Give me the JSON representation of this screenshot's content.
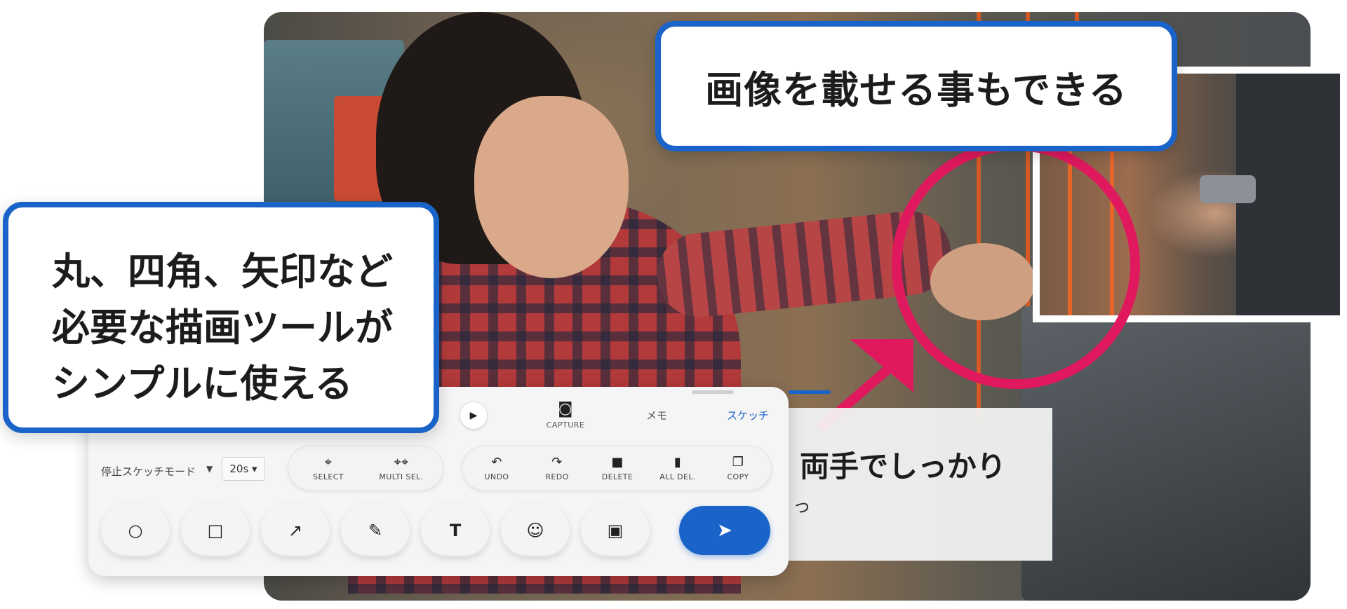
{
  "callouts": {
    "top": "画像を載せる事もできる",
    "left_lines": [
      "丸、四角、矢印など",
      "必要な描画ツールが",
      "シンプルに使える"
    ]
  },
  "memo": {
    "text": "両手でしっかり",
    "subtext": "っ"
  },
  "panel": {
    "play_icon": "play-icon",
    "tabs": {
      "capture": {
        "icon": "camera-icon",
        "label": "CAPTURE"
      },
      "memo": {
        "label": "メモ"
      },
      "sketch": {
        "label": "スケッチ",
        "active": true
      }
    },
    "mode": {
      "label": "停止スケッチモード",
      "duration": "20s ▾"
    },
    "selection_tools": [
      {
        "icon": "cursor-icon",
        "label": "SELECT"
      },
      {
        "icon": "multi-cursor-icon",
        "label": "MULTI SEL."
      }
    ],
    "edit_tools": [
      {
        "icon": "undo-icon",
        "label": "UNDO"
      },
      {
        "icon": "redo-icon",
        "label": "REDO"
      },
      {
        "icon": "trash-icon",
        "label": "DELETE"
      },
      {
        "icon": "trash-all-icon",
        "label": "ALL DEL."
      },
      {
        "icon": "copy-icon",
        "label": "COPY"
      }
    ],
    "draw_tools": [
      {
        "icon": "circle-icon",
        "glyph": "○"
      },
      {
        "icon": "square-icon",
        "glyph": "□"
      },
      {
        "icon": "arrow-icon",
        "glyph": "↗"
      },
      {
        "icon": "freehand-icon",
        "glyph": "✎"
      },
      {
        "icon": "text-icon",
        "glyph": "T"
      },
      {
        "icon": "emoji-icon",
        "glyph": "☺"
      },
      {
        "icon": "image-icon",
        "glyph": "▣"
      }
    ],
    "send_icon": "send-icon"
  },
  "colors": {
    "accent": "#1a63c8",
    "annotation": "#e0195f",
    "panel_bg": "#f5f5f6"
  }
}
